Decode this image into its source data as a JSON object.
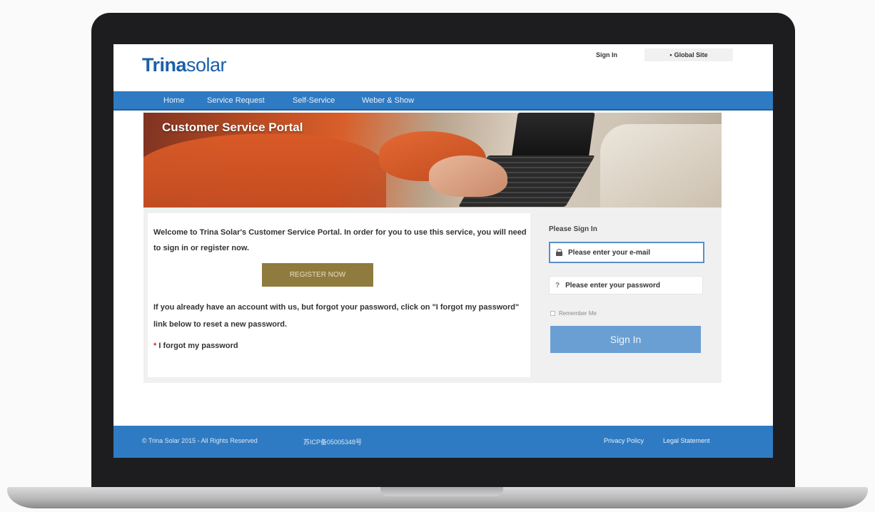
{
  "header": {
    "logo_bold": "Trina",
    "logo_regular": "solar",
    "sign_in_label": "Sign In",
    "global_site_label": "Global Site"
  },
  "nav": {
    "items": [
      {
        "label": "Home"
      },
      {
        "label": "Service Request"
      },
      {
        "label": "Self-Service"
      },
      {
        "label": "Weber & Show"
      }
    ]
  },
  "hero": {
    "title": "Customer Service Portal"
  },
  "welcome": {
    "text": "Welcome to Trina Solar's Customer Service Portal. In order for you to use this service, you will need to sign in or register now.",
    "register_label": "REGISTER NOW",
    "forgot_text": "If you already have an account with us, but forgot your password, click on \"I forgot my password\" link below to reset a new password.",
    "forgot_link_marker": "*",
    "forgot_link_label": "I forgot my password"
  },
  "signin": {
    "title": "Please Sign In",
    "email_placeholder": "Please enter your e-mail",
    "password_placeholder": "Please enter your password",
    "remember_label": "Remember Me",
    "button_label": "Sign In"
  },
  "footer": {
    "copyright": "© Trina Solar 2015 - All Rights Reserved",
    "icp": "苏ICP备05005348号",
    "privacy_label": "Privacy Policy",
    "legal_label": "Legal Statement"
  },
  "colors": {
    "brand_blue": "#2f7bc3",
    "register_gold": "#8f7b3d",
    "signin_button": "#6a9fd4"
  }
}
